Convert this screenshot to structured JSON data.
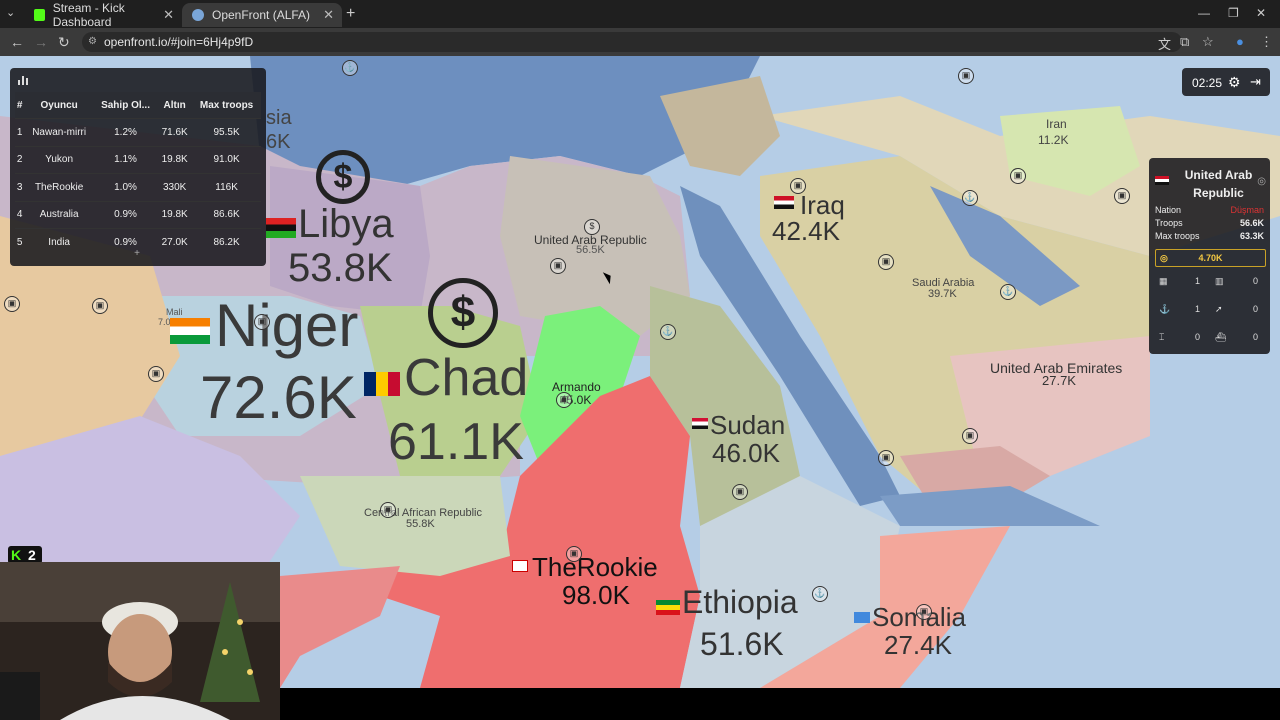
{
  "browser": {
    "tabs": [
      {
        "label": "Stream - Kick Dashboard",
        "favicon_color": "#53fc18"
      },
      {
        "label": "OpenFront (ALFA)",
        "favicon_color": "#7aa6d8"
      }
    ],
    "url": "openfront.io/#join=6Hj4p9fD"
  },
  "leaderboard": {
    "headers": [
      "#",
      "Oyuncu",
      "Sahip Ol...",
      "Altın",
      "Max troops"
    ],
    "rows": [
      [
        "1",
        "Nawan-mirri",
        "1.2%",
        "71.6K",
        "95.5K"
      ],
      [
        "2",
        "Yukon",
        "1.1%",
        "19.8K",
        "91.0K"
      ],
      [
        "3",
        "TheRookie",
        "1.0%",
        "330K",
        "116K"
      ],
      [
        "4",
        "Australia",
        "0.9%",
        "19.8K",
        "86.6K"
      ],
      [
        "5",
        "India",
        "0.9%",
        "27.0K",
        "86.2K"
      ]
    ],
    "expand": "+"
  },
  "timer": "02:25",
  "info_panel": {
    "title": "United Arab Republic",
    "nation_label": "Nation",
    "nation_value": "Düşman",
    "troops_label": "Troops",
    "troops_value": "56.6K",
    "max_troops_label": "Max troops",
    "max_troops_value": "63.3K",
    "gold": "4.70K",
    "stats": [
      "1",
      "0",
      "1",
      "0",
      "0",
      "0"
    ]
  },
  "map": {
    "countries": [
      {
        "name": "Niger",
        "troops": "72.6K"
      },
      {
        "name": "Chad",
        "troops": "61.1K"
      },
      {
        "name": "Libya",
        "troops": "53.8K"
      },
      {
        "name": "Iraq",
        "troops": "42.4K"
      },
      {
        "name": "Sudan",
        "troops": "46.0K"
      },
      {
        "name": "TheRookie",
        "troops": "98.0K"
      },
      {
        "name": "Ethiopia",
        "troops": "51.6K"
      },
      {
        "name": "Somalia",
        "troops": "27.4K"
      },
      {
        "name": "United Arab Republic",
        "troops": "56.5K"
      },
      {
        "name": "Armando",
        "troops": "45.0K"
      },
      {
        "name": "Saudi Arabia",
        "troops": "39.7K"
      },
      {
        "name": "United Arab Emirates",
        "troops": "27.7K"
      },
      {
        "name": "Central African Republic",
        "troops": "55.8K"
      },
      {
        "name": "Iran",
        "troops": "11.2K"
      },
      {
        "name": "Mali",
        "troops": "7.0K"
      },
      {
        "name": "sia",
        "troops": "6K"
      }
    ]
  },
  "stream": {
    "kick_badge": "2"
  }
}
